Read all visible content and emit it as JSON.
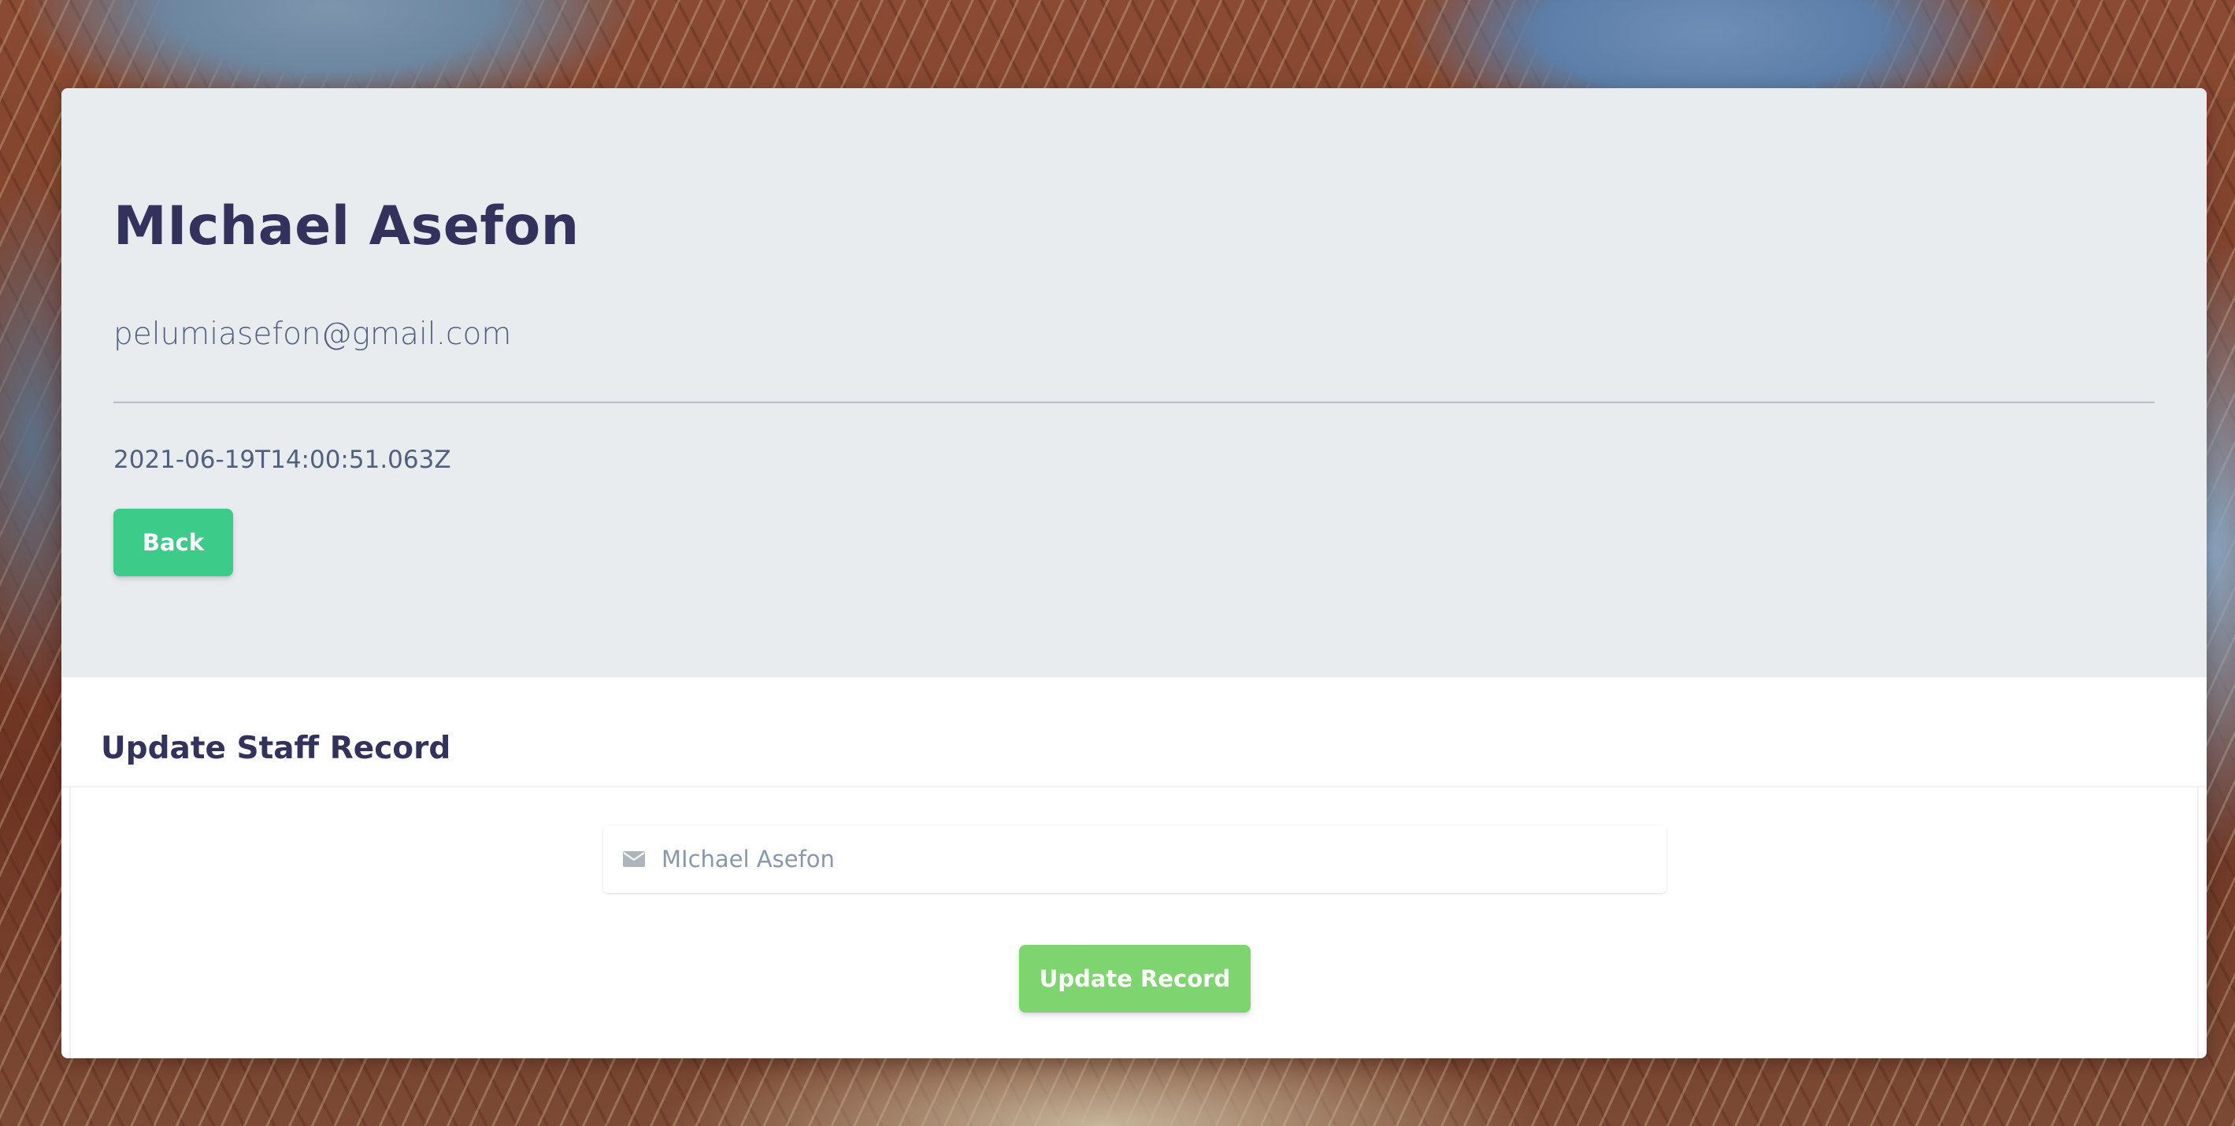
{
  "profile": {
    "name": "MIchael Asefon",
    "email": "pelumiasefon@gmail.com",
    "created_at": "2021-06-19T14:00:51.063Z",
    "back_label": "Back"
  },
  "update_form": {
    "title": "Update Staff Record",
    "name_field": {
      "value": "MIchael Asefon",
      "icon": "envelope-icon"
    },
    "submit_label": "Update Record"
  },
  "colors": {
    "heading": "#32325d",
    "text": "#525f7f",
    "hero_bg": "#e9ecef",
    "back_button": "#3ccb89",
    "update_button": "#7ed56f",
    "input_icon": "#adb5bd"
  }
}
